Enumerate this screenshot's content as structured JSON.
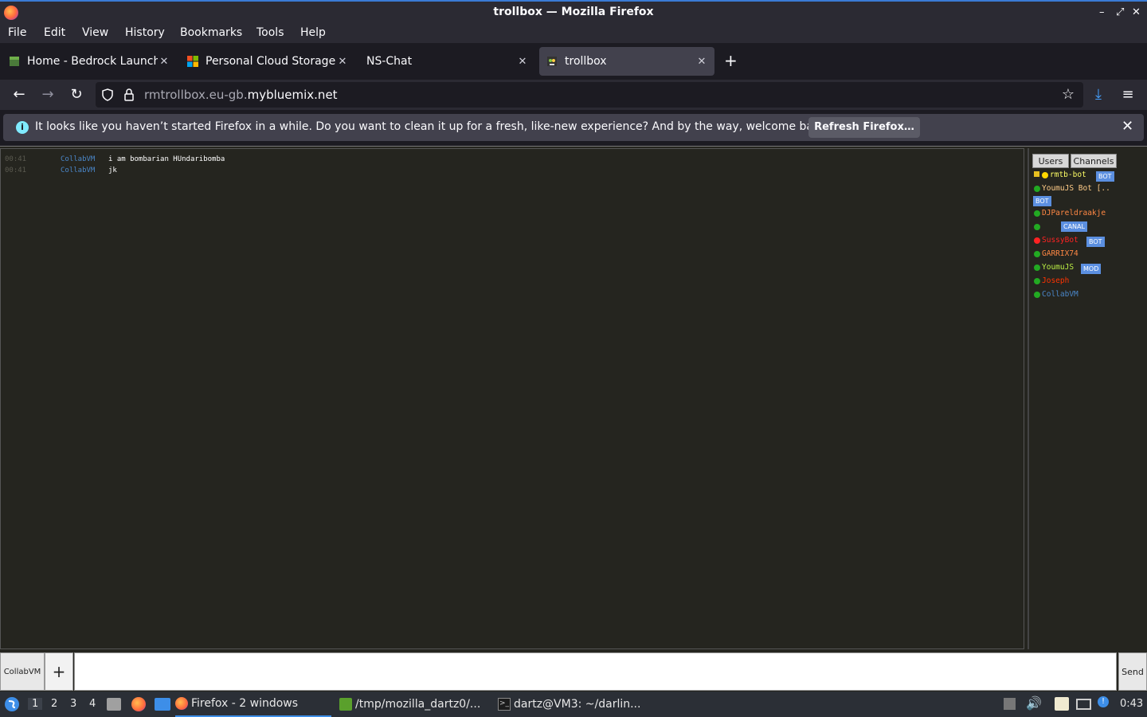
{
  "window": {
    "title": "trollbox — Mozilla Firefox"
  },
  "menu": {
    "file": "File",
    "edit": "Edit",
    "view": "View",
    "history": "History",
    "bookmarks": "Bookmarks",
    "tools": "Tools",
    "help": "Help"
  },
  "tabs": [
    {
      "label": "Home - Bedrock Launcher"
    },
    {
      "label": "Personal Cloud Storage - "
    },
    {
      "label": "NS-Chat"
    },
    {
      "label": "trollbox"
    }
  ],
  "urlbar": {
    "domain_prefix": "rmtrollbox.eu-gb.",
    "domain_main": "mybluemix.net"
  },
  "infobar": {
    "message": "It looks like you haven’t started Firefox in a while. Do you want to clean it up for a fresh, like-new experience? And by the way, welcome back!",
    "button": "Refresh Firefox…"
  },
  "chat": {
    "messages": [
      {
        "time": "00:41",
        "nick": "CollabVM",
        "text": "i am bombarian HUndaribomba"
      },
      {
        "time": "00:41",
        "nick": "CollabVM",
        "text": "jk"
      }
    ]
  },
  "sidebar": {
    "tabs": {
      "users": "Users",
      "channels": "Channels"
    },
    "users": [
      {
        "name": "rmtb-bot",
        "color": "#ffff66",
        "dot": "#ffd700",
        "badge": "BOT"
      },
      {
        "name": "YoumuJS Bot [..",
        "color": "#ffcc88",
        "dot": "#22aa22",
        "badge": "BOT"
      },
      {
        "name": "DJPareldraakje",
        "color": "#ff8844",
        "dot": "#22aa22",
        "badge": ""
      },
      {
        "name": "",
        "color": "#2244ff",
        "dot": "#22aa22",
        "badge": "CANAL"
      },
      {
        "name": "SussyBot",
        "color": "#ff2222",
        "dot": "#ff2222",
        "badge": "BOT"
      },
      {
        "name": "GARRIX74",
        "color": "#ff8844",
        "dot": "#22aa22",
        "badge": ""
      },
      {
        "name": "YoumuJS",
        "color": "#bbee44",
        "dot": "#22aa22",
        "badge": "MOD"
      },
      {
        "name": "Joseph",
        "color": "#ff3300",
        "dot": "#22aa22",
        "badge": ""
      },
      {
        "name": "CollabVM",
        "color": "#4a86c8",
        "dot": "#22aa22",
        "badge": ""
      }
    ]
  },
  "input": {
    "room": "CollabVM",
    "plus": "+",
    "send": "Send"
  },
  "taskbar": {
    "workspaces": [
      "1",
      "2",
      "3",
      "4"
    ],
    "items": [
      {
        "label": "Firefox - 2 windows"
      },
      {
        "label": "/tmp/mozilla_dartz0/..."
      },
      {
        "label": "dartz@VM3: ~/darlin..."
      }
    ],
    "clock": "0:43"
  }
}
